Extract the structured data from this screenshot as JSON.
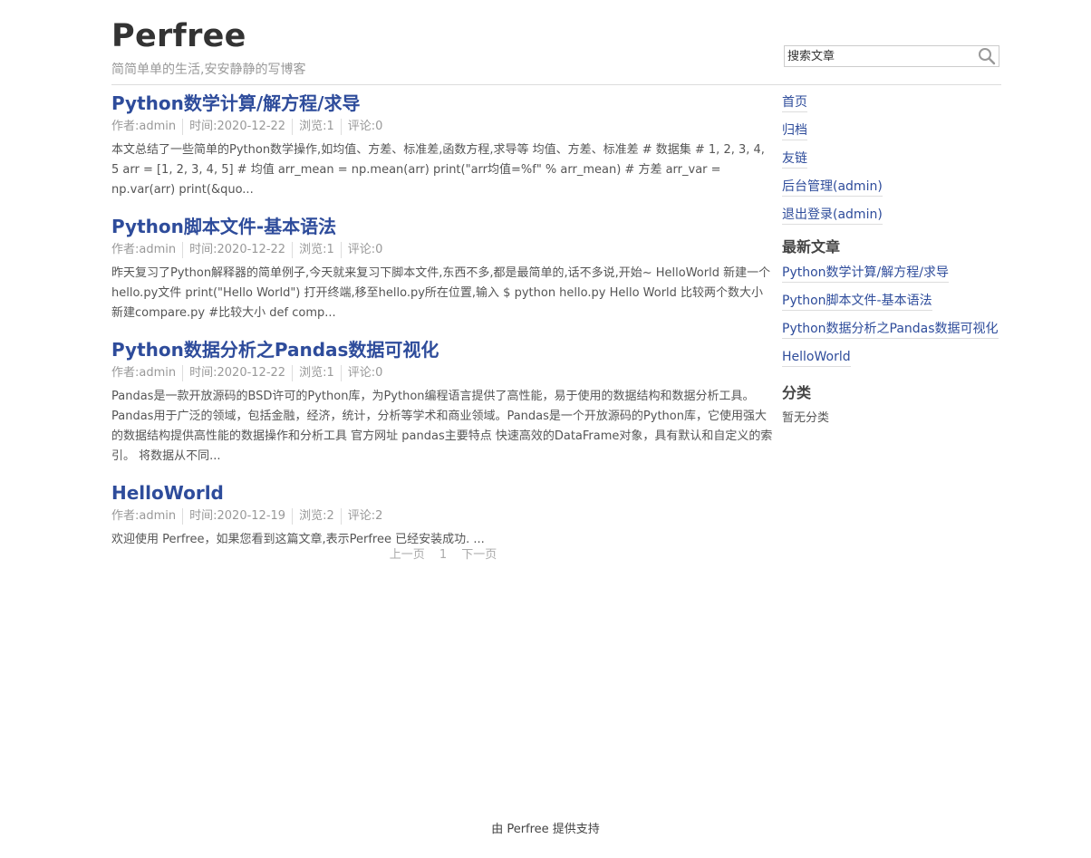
{
  "header": {
    "site_title": "Perfree",
    "site_desc": "简简单单的生活,安安静静的写博客",
    "search_placeholder": "搜索文章",
    "search_icon": "magnifier-icon"
  },
  "posts": [
    {
      "title": "Python数学计算/解方程/求导",
      "author": "作者:admin",
      "time": "时间:2020-12-22",
      "views": "浏览:1",
      "comments": "评论:0",
      "excerpt": "本文总结了一些简单的Python数学操作,如均值、方差、标准差,函数方程,求导等 均值、方差、标准差 # 数据集 # 1, 2, 3, 4, 5 arr = [1, 2, 3, 4, 5] # 均值 arr_mean = np.mean(arr) print(\"arr均值=%f\" % arr_mean) # 方差 arr_var = np.var(arr) print(&quo..."
    },
    {
      "title": "Python脚本文件-基本语法",
      "author": "作者:admin",
      "time": "时间:2020-12-22",
      "views": "浏览:1",
      "comments": "评论:0",
      "excerpt": "昨天复习了Python解释器的简单例子,今天就来复习下脚本文件,东西不多,都是最简单的,话不多说,开始~ HelloWorld 新建一个hello.py文件 print(\"Hello World\") 打开终端,移至hello.py所在位置,输入 $ python hello.py Hello World 比较两个数大小 新建compare.py #比较大小 def comp..."
    },
    {
      "title": "Python数据分析之Pandas数据可视化",
      "author": "作者:admin",
      "time": "时间:2020-12-22",
      "views": "浏览:1",
      "comments": "评论:0",
      "excerpt": "Pandas是一款开放源码的BSD许可的Python库，为Python编程语言提供了高性能，易于使用的数据结构和数据分析工具。Pandas用于广泛的领域，包括金融，经济，统计，分析等学术和商业领域。Pandas是一个开放源码的Python库，它使用强大的数据结构提供高性能的数据操作和分析工具 官方网址 pandas主要特点 快速高效的DataFrame对象，具有默认和自定义的索引。 将数据从不同..."
    },
    {
      "title": "HelloWorld",
      "author": "作者:admin",
      "time": "时间:2020-12-19",
      "views": "浏览:2",
      "comments": "评论:2",
      "excerpt": "欢迎使用 Perfree，如果您看到这篇文章,表示Perfree 已经安装成功. ..."
    }
  ],
  "pager": {
    "prev": "上一页",
    "current": "1",
    "next": "下一页"
  },
  "sidebar": {
    "nav": [
      "首页",
      "归档",
      "友链",
      "后台管理(admin)",
      "退出登录(admin)"
    ],
    "recent_title": "最新文章",
    "recent": [
      "Python数学计算/解方程/求导",
      "Python脚本文件-基本语法",
      "Python数据分析之Pandas数据可视化",
      "HelloWorld"
    ],
    "category_title": "分类",
    "category_empty": "暂无分类"
  },
  "footer": {
    "text": "由 Perfree 提供支持"
  },
  "colors": {
    "link": "#2e4c9b",
    "meta": "#999999",
    "divider": "#dddddd"
  }
}
